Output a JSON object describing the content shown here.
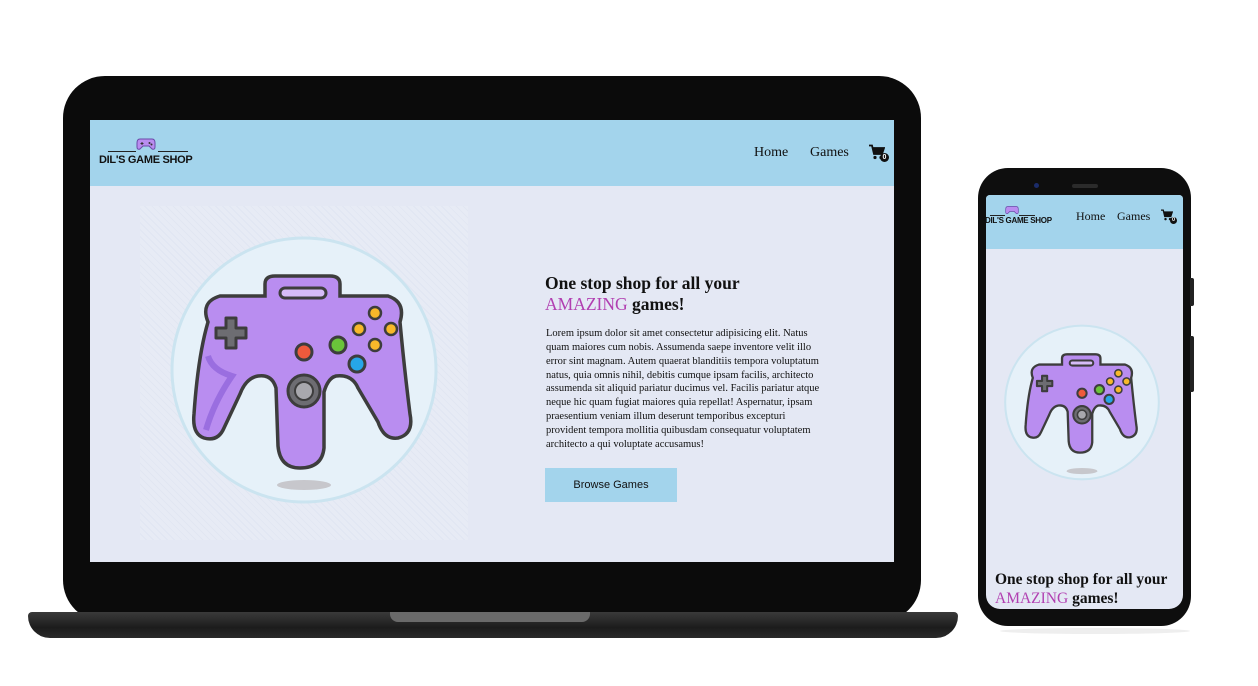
{
  "site": {
    "logo_text": "DIL'S GAME SHOP",
    "nav": {
      "home_label": "Home",
      "games_label": "Games"
    },
    "cart_count": "0"
  },
  "hero": {
    "heading_line1": "One stop shop for all your",
    "heading_highlight": "AMAZING",
    "heading_end": "games!",
    "body": "Lorem ipsum dolor sit amet consectetur adipisicing elit. Natus quam maiores cum nobis. Assumenda saepe inventore velit illo error sint magnam. Autem quaerat blanditiis tempora voluptatum natus, quia omnis nihil, debitis cumque ipsam facilis, architecto assumenda sit aliquid pariatur ducimus vel. Facilis pariatur atque neque hic quam fugiat maiores quia repellat! Aspernatur, ipsam praesentium veniam illum deserunt temporibus excepturi provident tempora mollitia quibusdam consequatur voluptatem architecto a qui voluptate accusamus!",
    "button_label": "Browse Games"
  },
  "icons": [
    "gamepad-logo-icon",
    "cart-icon",
    "controller-illustration"
  ],
  "colors": {
    "header": "#a3d4ec",
    "page_bg": "#e4e8f4",
    "accent_text": "#b13fb1",
    "controller": "#b98df0"
  }
}
